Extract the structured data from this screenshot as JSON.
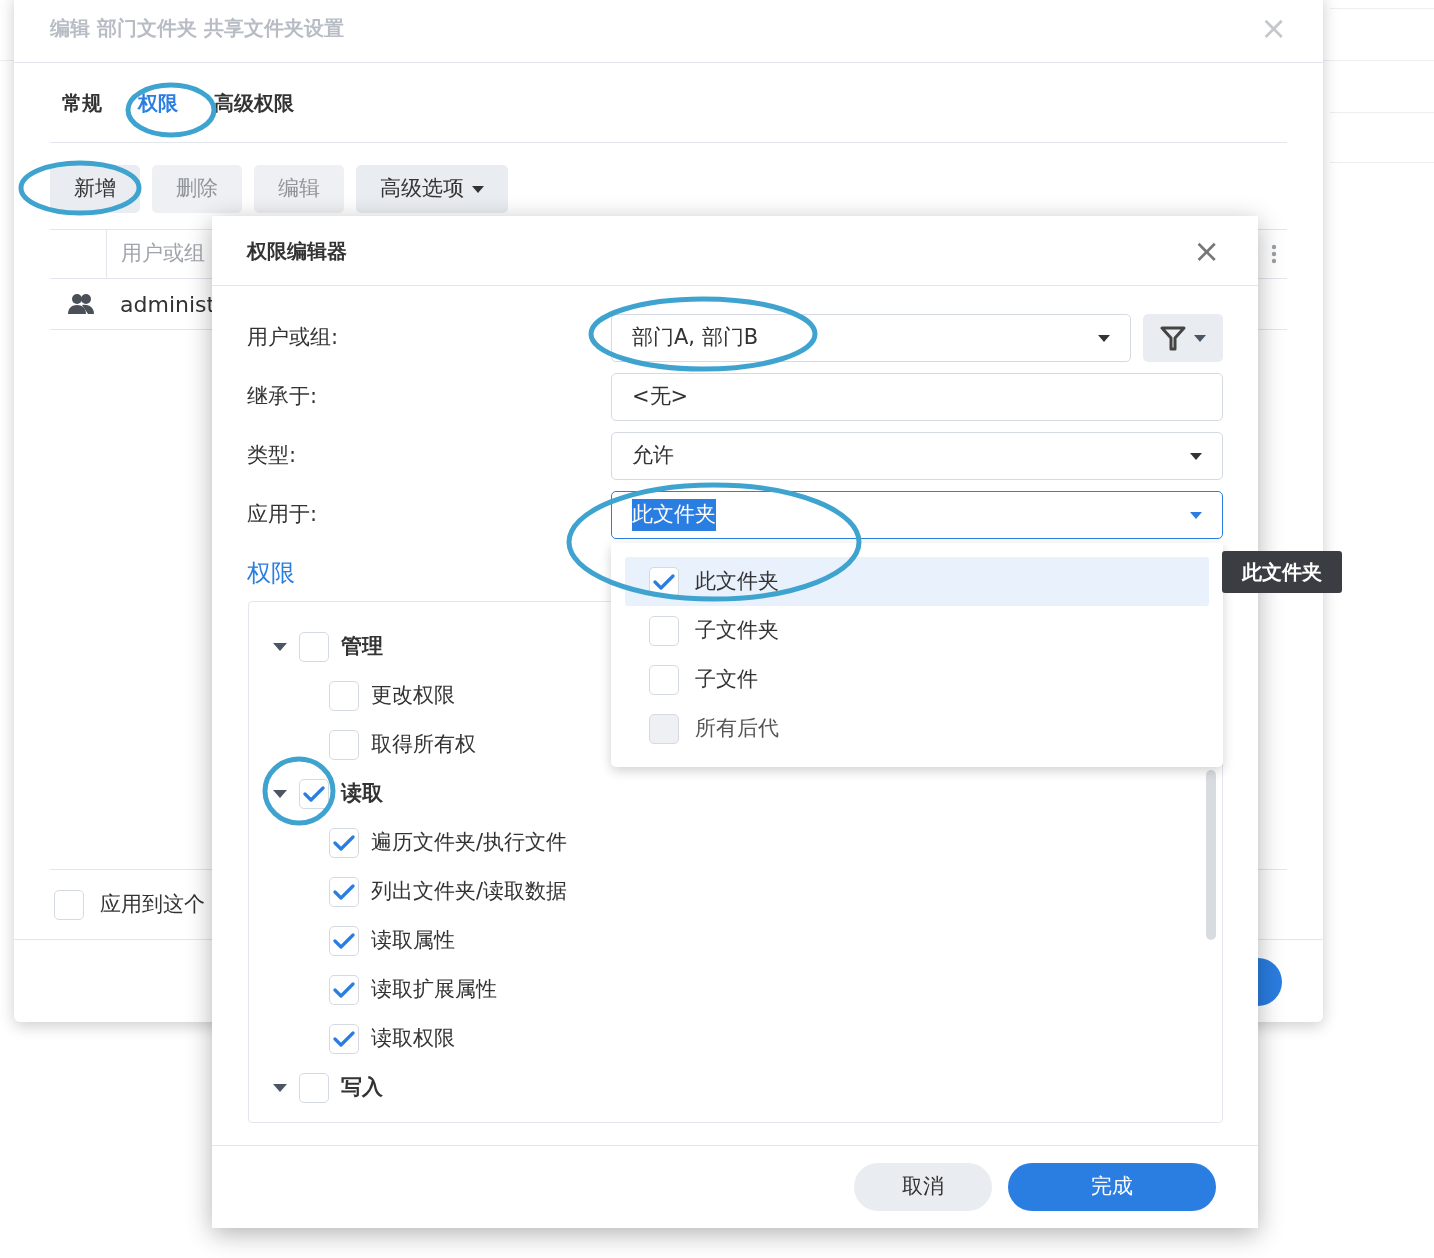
{
  "back_dialog": {
    "title": "编辑 部门文件夹 共享文件夹设置",
    "close": "×",
    "tabs": [
      {
        "label": "常规",
        "selected": false
      },
      {
        "label": "权限",
        "selected": true
      },
      {
        "label": "高级权限",
        "selected": false
      }
    ],
    "toolbar": [
      {
        "label": "新增",
        "disabled": false,
        "dropdown": false
      },
      {
        "label": "删除",
        "disabled": true,
        "dropdown": false
      },
      {
        "label": "编辑",
        "disabled": true,
        "dropdown": false
      },
      {
        "label": "高级选项",
        "disabled": false,
        "dropdown": true
      }
    ],
    "table": {
      "columns": [
        "用户或组"
      ],
      "rows": [
        {
          "name": "administ"
        }
      ]
    },
    "apply_checkbox": {
      "label": "应用到这个",
      "checked": false
    }
  },
  "editor": {
    "title": "权限编辑器",
    "close": "×",
    "fields": [
      {
        "kind": "select",
        "label": "用户或组:",
        "value": "部门A, 部门B",
        "focused": false
      },
      {
        "kind": "text",
        "label": "继承于:",
        "value": "<无>",
        "focused": false
      },
      {
        "kind": "select",
        "label": "类型:",
        "value": "允许",
        "focused": false
      },
      {
        "kind": "select",
        "label": "应用于:",
        "value": "此文件夹",
        "focused": true
      }
    ],
    "section_title": "权限",
    "tree": [
      {
        "label": "管理",
        "checked": false,
        "expanded": true,
        "children": [
          {
            "label": "更改权限",
            "checked": false
          },
          {
            "label": "取得所有权",
            "checked": false
          }
        ]
      },
      {
        "label": "读取",
        "checked": true,
        "expanded": true,
        "children": [
          {
            "label": "遍历文件夹/执行文件",
            "checked": true
          },
          {
            "label": "列出文件夹/读取数据",
            "checked": true
          },
          {
            "label": "读取属性",
            "checked": true
          },
          {
            "label": "读取扩展属性",
            "checked": true
          },
          {
            "label": "读取权限",
            "checked": true
          }
        ]
      },
      {
        "label": "写入",
        "checked": false,
        "expanded": true
      }
    ],
    "dropdown": [
      {
        "label": "此文件夹",
        "checked": true,
        "selected": true,
        "disabled": false
      },
      {
        "label": "子文件夹",
        "checked": false,
        "selected": false,
        "disabled": false
      },
      {
        "label": "子文件",
        "checked": false,
        "selected": false,
        "disabled": false
      },
      {
        "label": "所有后代",
        "checked": false,
        "selected": false,
        "disabled": true
      }
    ],
    "tooltip": "此文件夹",
    "buttons": [
      {
        "label": "取消",
        "primary": false
      },
      {
        "label": "完成",
        "primary": true
      }
    ]
  }
}
